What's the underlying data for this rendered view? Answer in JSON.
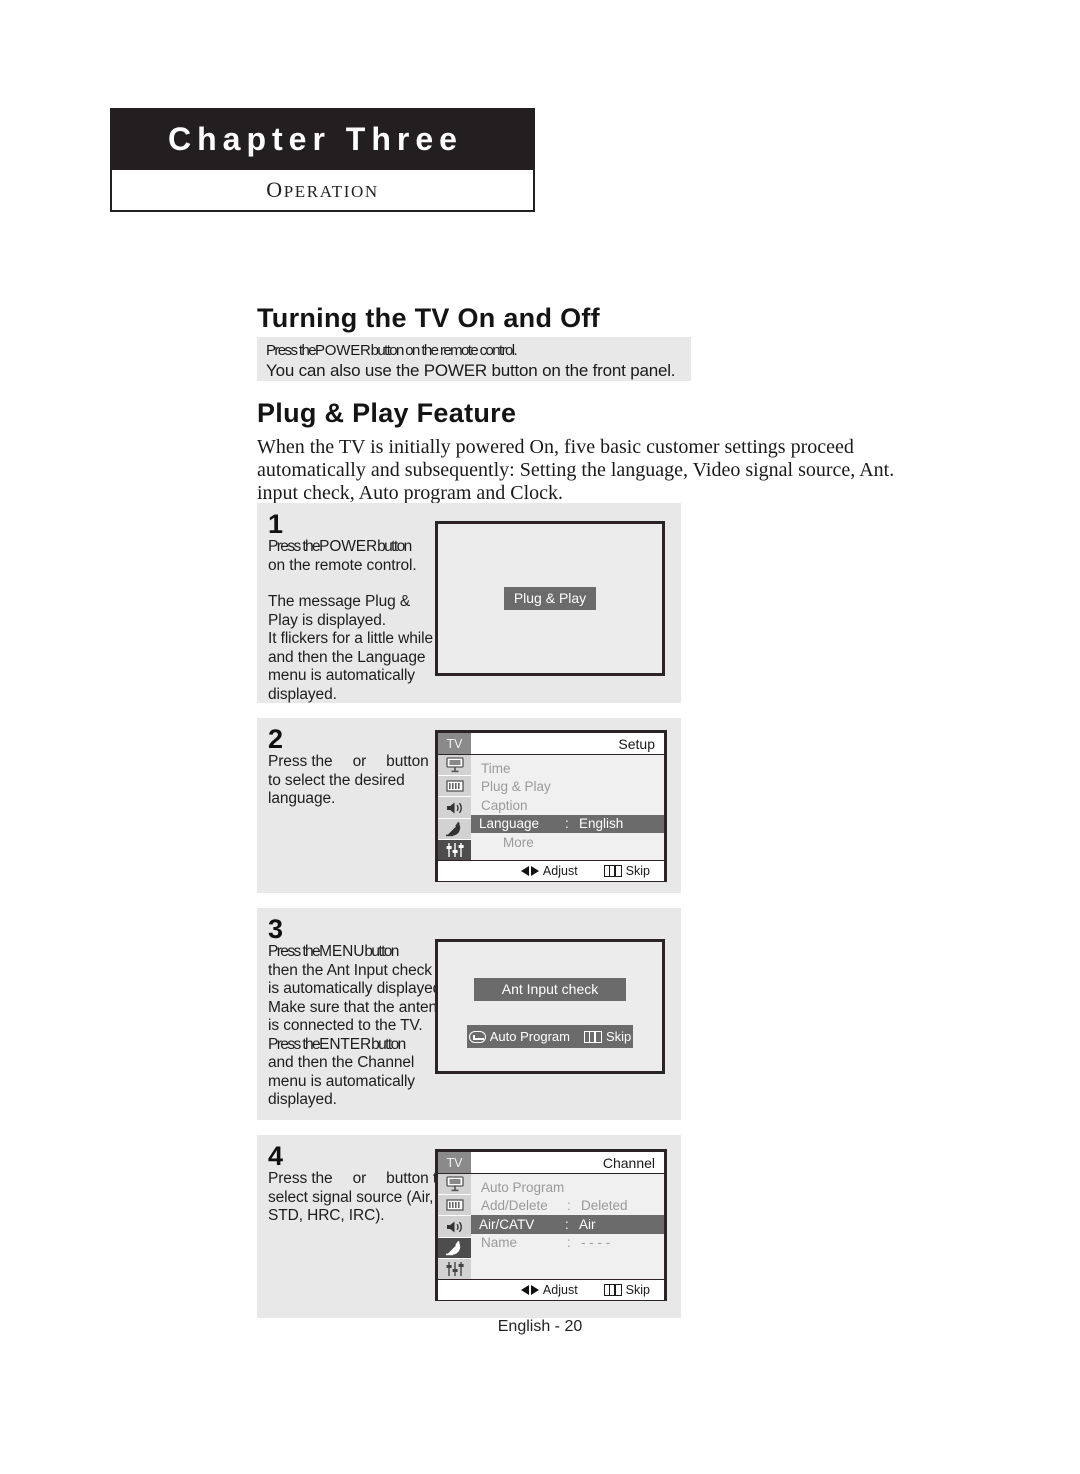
{
  "chapter": {
    "title": "Chapter Three",
    "subtitle_first": "O",
    "subtitle_rest": "PERATION"
  },
  "sections": {
    "turning_heading": "Turning the TV On and Off",
    "note_line_1_a": "Press the",
    "note_line_1_b": "POWER",
    "note_line_1_c": "button on the remote control.",
    "note_line_2": "You can also use the POWER button on the front panel.",
    "plug_heading": "Plug & Play Feature",
    "intro": "When the TV is initially powered On, five basic customer settings proceed automatically and subsequently: Setting the language, Video signal source, Ant. input check, Auto program and Clock."
  },
  "steps": [
    {
      "number": "1",
      "line1_a": "Press the",
      "line1_b": "POWER",
      "line1_c": "button",
      "line2": "on the remote control.",
      "line3": "The message  Plug &",
      "line4": "Play  is displayed.",
      "line5": "It flickers for a little while",
      "line6": "and then the  Language",
      "line7": "menu is automatically",
      "line8": "displayed.",
      "screen": {
        "chip": "Plug & Play"
      }
    },
    {
      "number": "2",
      "line1_a": "Press the",
      "line1_b": "or",
      "line1_c": "button",
      "line2": "to select the desired",
      "line3": "language.",
      "osd": {
        "tv_tag": "TV",
        "title": "Setup",
        "rows": [
          {
            "key": "Time",
            "sep": "",
            "value": "",
            "selected": false,
            "indent": false
          },
          {
            "key": "Plug & Play",
            "sep": "",
            "value": "",
            "selected": false,
            "indent": false
          },
          {
            "key": "Caption",
            "sep": "",
            "value": "",
            "selected": false,
            "indent": false
          },
          {
            "key": "Language",
            "sep": ":",
            "value": "English",
            "selected": true,
            "indent": false
          },
          {
            "key": "More",
            "sep": "",
            "value": "",
            "selected": false,
            "indent": true
          }
        ],
        "footer_adjust": "Adjust",
        "footer_skip": "Skip"
      }
    },
    {
      "number": "3",
      "line1_a": "Press the",
      "line1_b": "MENU",
      "line1_c": "button",
      "line2": "then the  Ant Input check",
      "line3": "is automatically displayed.",
      "line4": "Make sure that the antenna",
      "line5": "is connected to the TV.",
      "line6_a": "Press the",
      "line6_b": "ENTER",
      "line6_c": "button",
      "line7": "and then the  Channel",
      "line8": "menu is automatically",
      "line9": "displayed.",
      "screen": {
        "chip_top": "Ant Input check",
        "chip_bottom_auto": "Auto Program",
        "chip_bottom_skip": "Skip"
      }
    },
    {
      "number": "4",
      "line1_a": "Press the",
      "line1_b": "or",
      "line1_c": "button to",
      "line2": "select signal source (Air,",
      "line3": "STD, HRC, IRC).",
      "osd": {
        "tv_tag": "TV",
        "title": "Channel",
        "rows": [
          {
            "key": "Auto Program",
            "sep": "",
            "value": "",
            "selected": false,
            "indent": false
          },
          {
            "key": "Add/Delete",
            "sep": ":",
            "value": "Deleted",
            "selected": false,
            "indent": false
          },
          {
            "key": "Air/CATV",
            "sep": ":",
            "value": "Air",
            "selected": true,
            "indent": false
          },
          {
            "key": "Name",
            "sep": ":",
            "value": "- - - -",
            "selected": false,
            "indent": false
          }
        ],
        "footer_adjust": "Adjust",
        "footer_skip": "Skip"
      }
    }
  ],
  "icons": {
    "picture": "picture-icon",
    "channel": "channel-icon",
    "sound": "sound-icon",
    "satellite": "satellite-icon",
    "setup": "setup-icon",
    "enter": "enter-icon",
    "skip_bars": "skip-bars-icon",
    "left-right-arrow": "left-right-arrow-icon"
  },
  "colors": {
    "header_bar": "#231f20",
    "panel_bg": "#e8e8e8",
    "osd_highlight": "#6b6b6b",
    "osd_inactive_text": "#9a9a9a",
    "icon_col": "#d2d2d2",
    "icon_active": "#4d4d4d"
  },
  "footer": {
    "page_label": "English - 20"
  }
}
